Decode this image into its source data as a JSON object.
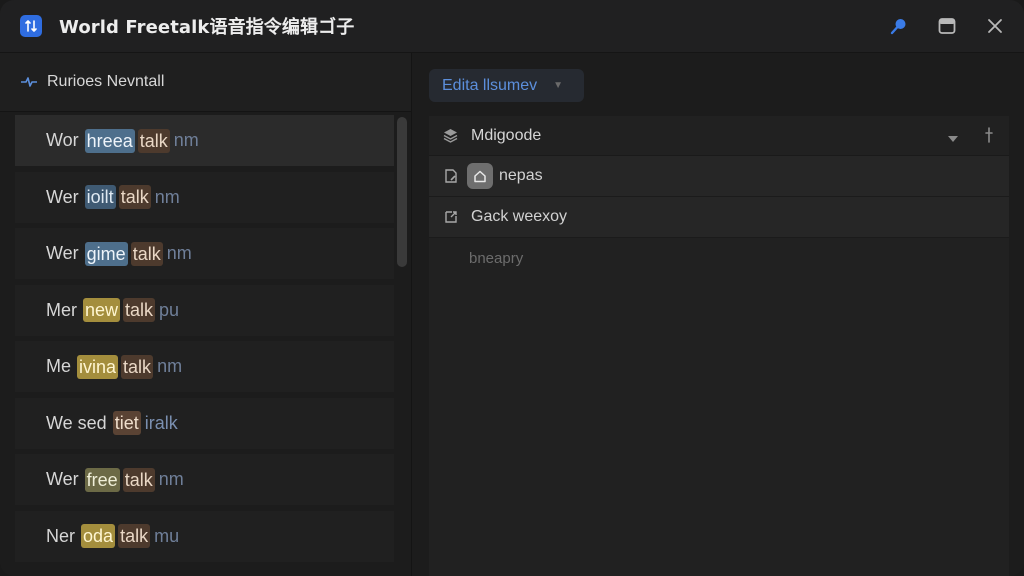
{
  "window": {
    "title": "World Freetalk语音指令编辑ゴ子",
    "app_icon_glyph": "↕"
  },
  "left_panel": {
    "header_label": "Rurioes Nevntall",
    "rows": [
      {
        "w1": "Wor",
        "w2": "hreea",
        "w2_color": "blue",
        "w3": "talk",
        "w3_color": "brown",
        "w4": "nm",
        "selected": true
      },
      {
        "w1": "Wer",
        "w2": "ioilt",
        "w2_color": "blue-dark",
        "w3": "talk",
        "w3_color": "brown",
        "w4": "nm",
        "selected": false
      },
      {
        "w1": "Wer",
        "w2": "gime",
        "w2_color": "blue",
        "w3": "talk",
        "w3_color": "brown",
        "w4": "nm",
        "selected": false
      },
      {
        "w1": "Mer",
        "w2": "new",
        "w2_color": "yellow",
        "w3": "talk",
        "w3_color": "brown",
        "w4": "pu",
        "selected": false
      },
      {
        "w1": "Me",
        "w2": "ivina",
        "w2_color": "yellow",
        "w3": "talk",
        "w3_color": "brown",
        "w4": "nm",
        "selected": false
      },
      {
        "w1": "We sed",
        "w2": "tiet",
        "w2_color": "brown-light",
        "w3": "",
        "w3_color": "",
        "w4": "iralk",
        "selected": false
      },
      {
        "w1": "Wer",
        "w2": "free",
        "w2_color": "olive",
        "w3": "talk",
        "w3_color": "brown",
        "w4": "nm",
        "selected": false
      },
      {
        "w1": "Ner",
        "w2": "oda",
        "w2_color": "yellow",
        "w3": "talk",
        "w3_color": "brown",
        "w4": "mu",
        "selected": false
      }
    ]
  },
  "right_panel": {
    "edit_button_label": "Edita llsumev",
    "section_title": "Mdigoode",
    "items": [
      {
        "label": "nepas",
        "has_badge": true
      },
      {
        "label": "Gack weexoy",
        "has_badge": false
      }
    ],
    "placeholder": "bneapry"
  },
  "colors": {
    "accent": "#2f6de1",
    "link_blue": "#5c8fdc"
  }
}
